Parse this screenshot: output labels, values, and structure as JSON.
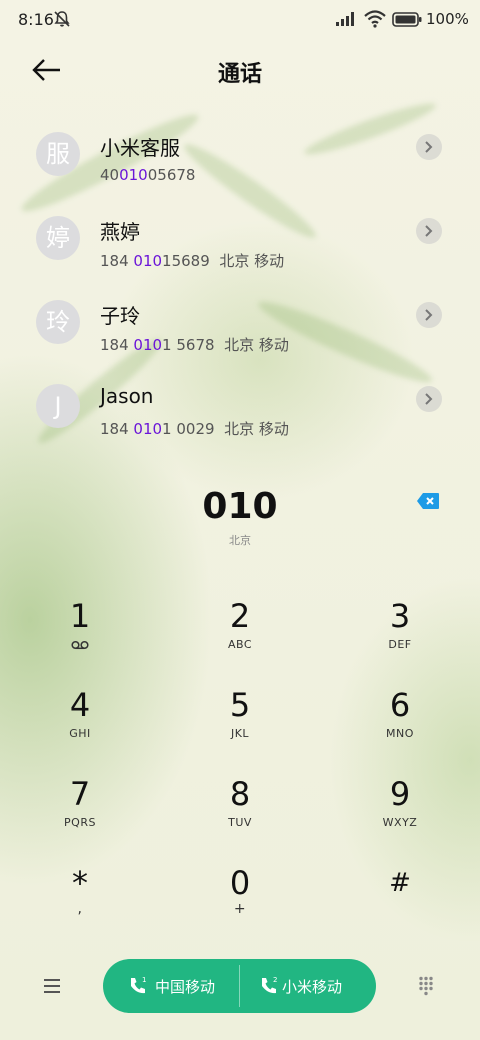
{
  "status_bar": {
    "time": "8:16",
    "battery": "100%"
  },
  "header": {
    "title": "通话"
  },
  "contacts": [
    {
      "avatar": "服",
      "name": "小米客服",
      "num_pre": "40",
      "num_hl": "010",
      "num_post": "05678",
      "location": ""
    },
    {
      "avatar": "婷",
      "name": "燕婷",
      "num_pre": "184 ",
      "num_hl": "010",
      "num_post": "15689",
      "location": "北京 移动"
    },
    {
      "avatar": "玲",
      "name": "子玲",
      "num_pre": "184 ",
      "num_hl": "010",
      "num_post": "1 5678",
      "location": "北京 移动"
    },
    {
      "avatar": "J",
      "name": "Jason",
      "num_pre": "184 ",
      "num_hl": "010",
      "num_post": "1 0029",
      "location": "北京 移动"
    }
  ],
  "dialer": {
    "number": "010",
    "region": "北京"
  },
  "keys": [
    {
      "digit": "1",
      "letters": ""
    },
    {
      "digit": "2",
      "letters": "ABC"
    },
    {
      "digit": "3",
      "letters": "DEF"
    },
    {
      "digit": "4",
      "letters": "GHI"
    },
    {
      "digit": "5",
      "letters": "JKL"
    },
    {
      "digit": "6",
      "letters": "MNO"
    },
    {
      "digit": "7",
      "letters": "PQRS"
    },
    {
      "digit": "8",
      "letters": "TUV"
    },
    {
      "digit": "9",
      "letters": "WXYZ"
    },
    {
      "digit": "*",
      "letters": ","
    },
    {
      "digit": "0",
      "letters": "+"
    },
    {
      "digit": "#",
      "letters": ""
    }
  ],
  "call_buttons": [
    {
      "sim": "1",
      "label": "中国移动"
    },
    {
      "sim": "2",
      "label": "小米移动"
    }
  ],
  "colors": {
    "accent": "#21b682",
    "highlight": "#6b16d8",
    "backspace": "#1e9be6"
  }
}
